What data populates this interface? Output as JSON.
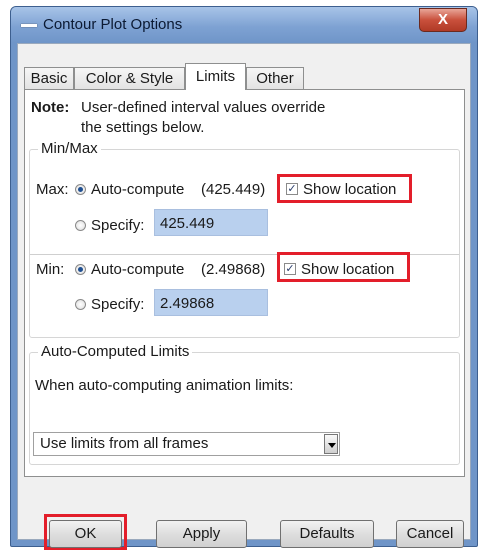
{
  "window": {
    "title": "Contour Plot Options",
    "close_glyph": "X"
  },
  "tabs": [
    {
      "label": "Basic"
    },
    {
      "label": "Color & Style"
    },
    {
      "label": "Limits"
    },
    {
      "label": "Other"
    }
  ],
  "active_tab": "Limits",
  "note": {
    "label": "Note:",
    "line1": "User-defined interval values override",
    "line2": "the settings below."
  },
  "minmax": {
    "group_title": "Min/Max",
    "max": {
      "label": "Max:",
      "auto_label": "Auto-compute",
      "auto_value": "(425.449)",
      "show_location": "Show location",
      "specify_label": "Specify:",
      "specify_value": "425.449"
    },
    "min": {
      "label": "Min:",
      "auto_label": "Auto-compute",
      "auto_value": "(2.49868)",
      "show_location": "Show location",
      "specify_label": "Specify:",
      "specify_value": "2.49868"
    }
  },
  "auto_limits": {
    "group_title": "Auto-Computed Limits",
    "prompt": "When auto-computing animation limits:",
    "selected": "Use limits from all frames"
  },
  "buttons": {
    "ok": "OK",
    "apply": "Apply",
    "defaults": "Defaults",
    "cancel": "Cancel"
  },
  "colors": {
    "highlight": "#e31e2a",
    "field_bg": "#b9d0ee",
    "title_bar": "#6f95c8"
  }
}
